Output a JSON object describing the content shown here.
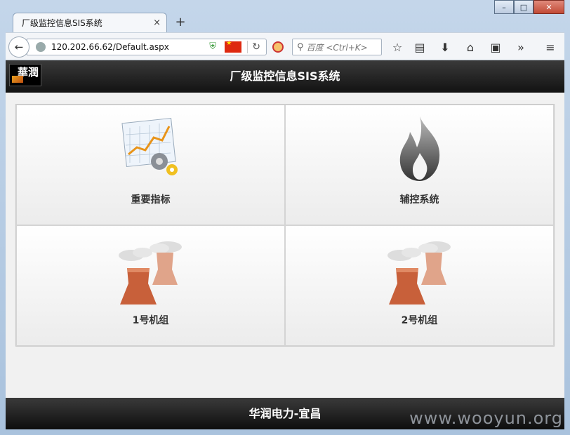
{
  "browser": {
    "tab_title": "厂级监控信息SIS系统",
    "tab_close": "×",
    "new_tab": "+",
    "url": "120.202.66.62/Default.aspx",
    "search_placeholder": "百度 <Ctrl+K>",
    "window_controls": {
      "minimize": "–",
      "maximize": "□",
      "close": "✕"
    }
  },
  "site": {
    "logo_text": "華潤",
    "title": "厂级监控信息SIS系统",
    "footer": "华润电力-宜昌"
  },
  "tiles": [
    {
      "label": "重要指标",
      "icon": "chart-gear-icon"
    },
    {
      "label": "辅控系统",
      "icon": "flame-icon"
    },
    {
      "label": "1号机组",
      "icon": "cooling-tower-icon"
    },
    {
      "label": "2号机组",
      "icon": "cooling-tower-icon"
    }
  ],
  "watermark": "www.wooyun.org",
  "colors": {
    "header_bg": "#1a1a1a",
    "page_bg": "#f1f1f1",
    "tower": "#c8603a"
  }
}
